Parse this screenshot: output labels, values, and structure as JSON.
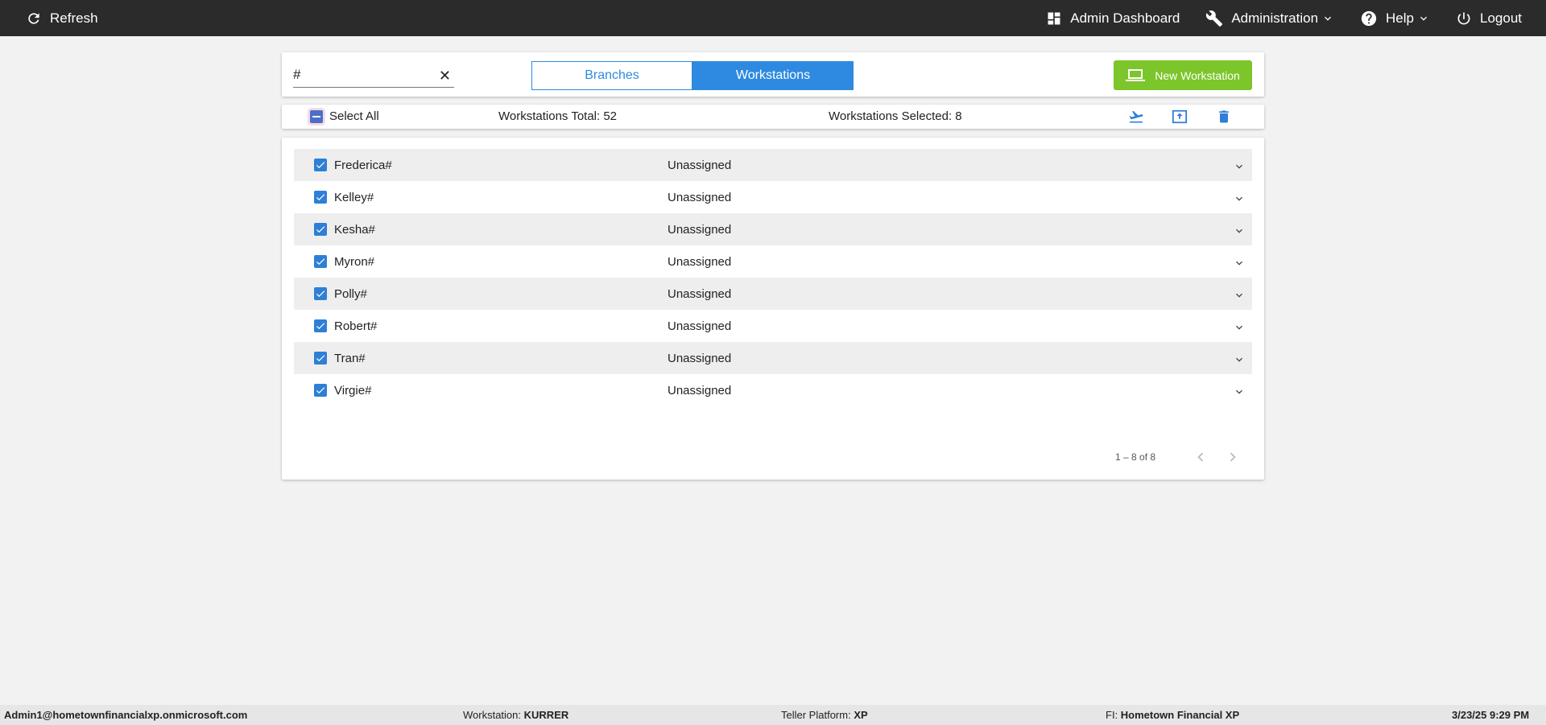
{
  "topbar": {
    "refresh": "Refresh",
    "admin_dashboard": "Admin Dashboard",
    "administration": "Administration",
    "help": "Help",
    "logout": "Logout"
  },
  "search": {
    "value": "#",
    "placeholder": ""
  },
  "tabs": {
    "branches": "Branches",
    "workstations": "Workstations",
    "active": "Workstations"
  },
  "new_workstation": "New Workstation",
  "selection": {
    "select_all": "Select All",
    "total": "Workstations Total: 52",
    "selected": "Workstations Selected: 8"
  },
  "rows": [
    {
      "name": "Frederica#",
      "status": "Unassigned",
      "checked": true
    },
    {
      "name": "Kelley#",
      "status": "Unassigned",
      "checked": true
    },
    {
      "name": "Kesha#",
      "status": "Unassigned",
      "checked": true
    },
    {
      "name": "Myron#",
      "status": "Unassigned",
      "checked": true
    },
    {
      "name": "Polly#",
      "status": "Unassigned",
      "checked": true
    },
    {
      "name": "Robert#",
      "status": "Unassigned",
      "checked": true
    },
    {
      "name": "Tran#",
      "status": "Unassigned",
      "checked": true
    },
    {
      "name": "Virgie#",
      "status": "Unassigned",
      "checked": true
    }
  ],
  "pager": {
    "range": "1 – 8 of 8"
  },
  "footer": {
    "user": "Admin1@hometownfinancialxp.onmicrosoft.com",
    "workstation_label": "Workstation:",
    "workstation_value": "KURRER",
    "platform_label": "Teller Platform:",
    "platform_value": "XP",
    "fi_label": "FI:",
    "fi_value": "Hometown Financial XP",
    "datetime": "3/23/25 9:29 PM"
  },
  "colors": {
    "accent": "#2e8ae0",
    "new_button": "#7cc52b",
    "topbar": "#2b2b2b"
  }
}
